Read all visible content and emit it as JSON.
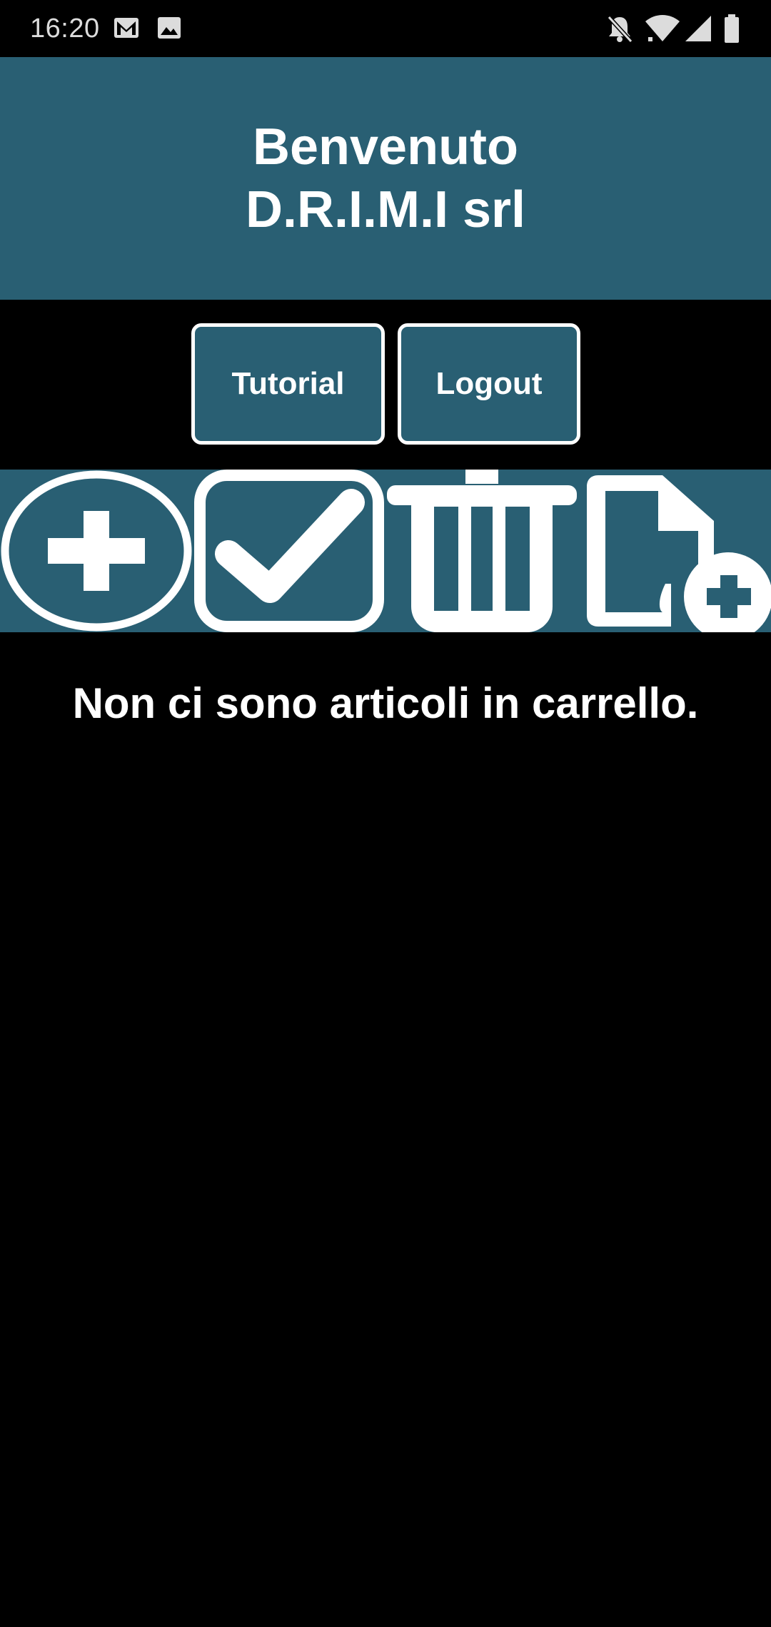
{
  "status_bar": {
    "time": "16:20",
    "notification_icons": [
      "gmail-icon",
      "image-icon"
    ],
    "system_icons": [
      "silent-bell-icon",
      "wifi-icon",
      "cell-signal-icon",
      "battery-icon"
    ]
  },
  "header": {
    "line1": "Benvenuto",
    "line2": "D.R.I.M.I srl",
    "background": "#295f73"
  },
  "buttons": {
    "tutorial_label": "Tutorial",
    "logout_label": "Logout"
  },
  "toolbar": {
    "items": [
      {
        "icon": "plus-circle-icon"
      },
      {
        "icon": "checkbox-icon"
      },
      {
        "icon": "trash-icon"
      },
      {
        "icon": "new-document-icon"
      }
    ]
  },
  "cart": {
    "empty_message": "Non ci sono articoli in carrello."
  },
  "colors": {
    "accent": "#295f73",
    "background": "#000000",
    "foreground": "#ffffff"
  }
}
